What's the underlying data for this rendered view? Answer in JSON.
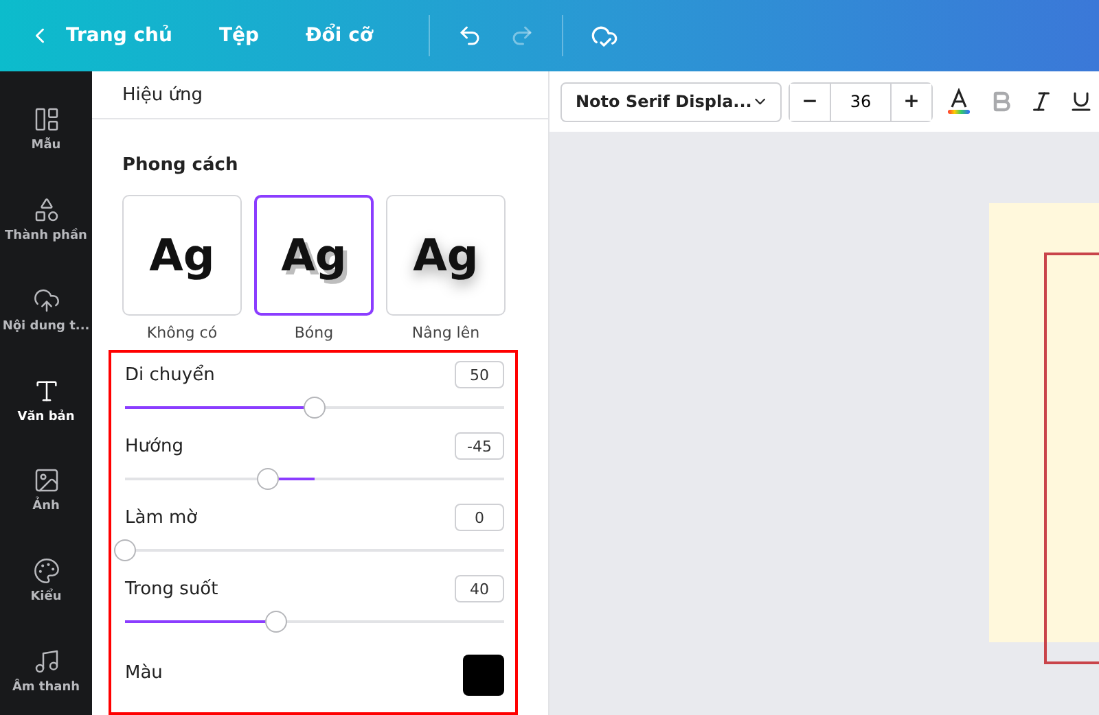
{
  "topbar": {
    "back": "Trang chủ",
    "menu": [
      "Tệp",
      "Đổi cỡ"
    ],
    "redo_disabled": true
  },
  "sidebar": {
    "items": [
      {
        "label": "Mẫu",
        "selected": false
      },
      {
        "label": "Thành phần",
        "selected": false
      },
      {
        "label": "Nội dung t...",
        "selected": false
      },
      {
        "label": "Văn bản",
        "selected": true
      },
      {
        "label": "Ảnh",
        "selected": false
      },
      {
        "label": "Kiểu",
        "selected": false
      },
      {
        "label": "Âm thanh",
        "selected": false
      }
    ]
  },
  "panel": {
    "title": "Hiệu ứng",
    "section": "Phong cách",
    "styles": [
      {
        "kind": "none",
        "sample": "Ag",
        "label": "Không có",
        "selected": false
      },
      {
        "kind": "shadow",
        "sample": "Ag",
        "label": "Bóng",
        "selected": true
      },
      {
        "kind": "lift",
        "sample": "Ag",
        "label": "Nâng lên",
        "selected": false
      }
    ],
    "controls": [
      {
        "kind": "slider",
        "label": "Di chuyển",
        "value": "50",
        "level": 0.5
      },
      {
        "kind": "bipolar",
        "label": "Hướng",
        "value": "-45",
        "level": 0.375
      },
      {
        "kind": "slider",
        "label": "Làm mờ",
        "value": "0",
        "level": 0
      },
      {
        "kind": "slider",
        "label": "Trong suốt",
        "value": "40",
        "level": 0.4
      },
      {
        "kind": "color",
        "label": "Màu",
        "color": "#000000"
      }
    ]
  },
  "toolbar": {
    "font": "Noto Serif Displa...",
    "minus": "−",
    "size": "36",
    "plus": "+",
    "bold_disabled": true
  }
}
